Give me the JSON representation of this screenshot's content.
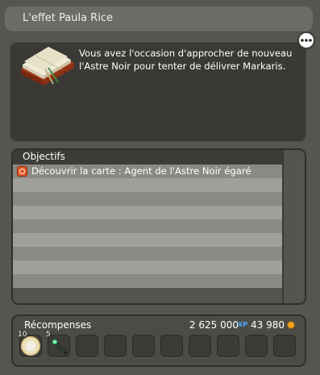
{
  "window": {
    "title": "L'effet Paula Rice"
  },
  "description": {
    "text": "Vous avez l'occasion d'approcher de nouveau l'Astre Noir pour tenter de délivrer Markaris.",
    "icon": "open-book-icon"
  },
  "more_button": {
    "icon": "more-dots-icon"
  },
  "objectives": {
    "header": "Objectifs",
    "items": [
      {
        "label": "Découvrir la carte : Agent de l'Astre Noir égaré",
        "icon": "location-target-icon"
      }
    ]
  },
  "rewards": {
    "label": "Récompenses",
    "xp_value": "2 625 000",
    "xp_unit": "XP",
    "kamas_value": "43 980",
    "kamas_icon": "kama-coin-icon",
    "items": [
      {
        "quantity": "10",
        "icon": "dofus-egg-item-icon"
      },
      {
        "quantity": "5",
        "icon": "magic-wand-item-icon"
      }
    ],
    "empty_slot_count": 8
  },
  "colors": {
    "background": "#55564f",
    "panel_dark": "#3a3935",
    "row_odd": "#8a8984",
    "row_even": "#a09f9a",
    "xp_accent": "#4aa8ff",
    "kama_accent": "#f0a020"
  }
}
